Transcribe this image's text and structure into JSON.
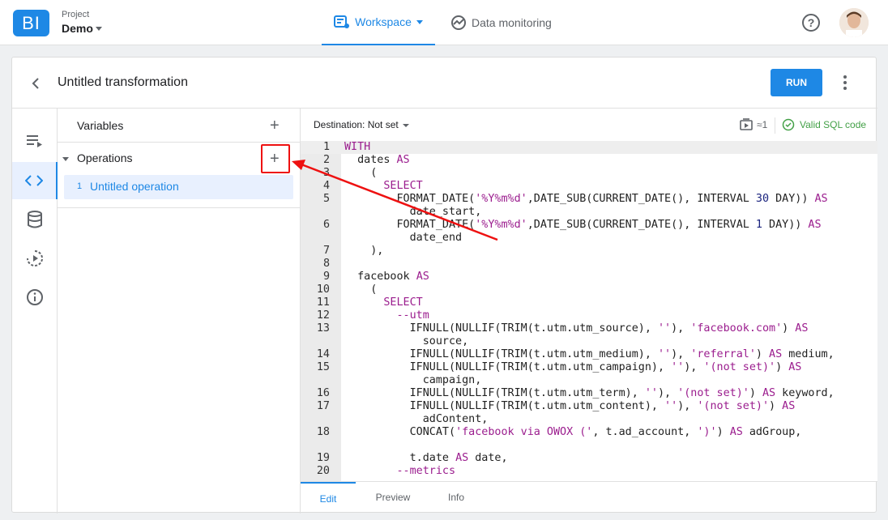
{
  "app": {
    "logo_text": "BI",
    "project_label": "Project",
    "project_name": "Demo",
    "nav": {
      "workspace": "Workspace",
      "data_monitoring": "Data monitoring"
    },
    "help_icon": "question-circle-icon",
    "accent": "#1e88e5"
  },
  "header": {
    "title": "Untitled transformation",
    "run_label": "RUN"
  },
  "panel": {
    "variables_label": "Variables",
    "operations_label": "Operations",
    "operations": [
      {
        "num": "1",
        "name": "Untitled operation"
      }
    ]
  },
  "editor": {
    "destination": "Destination: Not set",
    "run_count": "≈1",
    "valid_text": "Valid SQL code",
    "tabs": [
      "Edit",
      "Preview",
      "Info"
    ],
    "active_tab": "Edit"
  },
  "code_lines": [
    {
      "n": "1",
      "t": "WITH"
    },
    {
      "n": "2",
      "t": "  dates AS"
    },
    {
      "n": "3",
      "t": "    ("
    },
    {
      "n": "4",
      "t": "      SELECT"
    },
    {
      "n": "5",
      "t": "        FORMAT_DATE('%Y%m%d',DATE_SUB(CURRENT_DATE(), INTERVAL 30 DAY)) AS"
    },
    {
      "n": "",
      "t": "          date_start,"
    },
    {
      "n": "6",
      "t": "        FORMAT_DATE('%Y%m%d',DATE_SUB(CURRENT_DATE(), INTERVAL 1 DAY)) AS"
    },
    {
      "n": "",
      "t": "          date_end"
    },
    {
      "n": "7",
      "t": "    ),"
    },
    {
      "n": "8",
      "t": ""
    },
    {
      "n": "9",
      "t": "  facebook AS"
    },
    {
      "n": "10",
      "t": "    ("
    },
    {
      "n": "11",
      "t": "      SELECT"
    },
    {
      "n": "12",
      "t": "        --utm"
    },
    {
      "n": "13",
      "t": "          IFNULL(NULLIF(TRIM(t.utm.utm_source), ''), 'facebook.com') AS"
    },
    {
      "n": "",
      "t": "            source,"
    },
    {
      "n": "14",
      "t": "          IFNULL(NULLIF(TRIM(t.utm.utm_medium), ''), 'referral') AS medium,"
    },
    {
      "n": "15",
      "t": "          IFNULL(NULLIF(TRIM(t.utm.utm_campaign), ''), '(not set)') AS"
    },
    {
      "n": "",
      "t": "            campaign,"
    },
    {
      "n": "16",
      "t": "          IFNULL(NULLIF(TRIM(t.utm.utm_term), ''), '(not set)') AS keyword,"
    },
    {
      "n": "17",
      "t": "          IFNULL(NULLIF(TRIM(t.utm.utm_content), ''), '(not set)') AS"
    },
    {
      "n": "",
      "t": "            adContent,"
    },
    {
      "n": "18",
      "t": "          CONCAT('facebook via OWOX (', t.ad_account, ')') AS adGroup,"
    },
    {
      "n": "",
      "t": ""
    },
    {
      "n": "19",
      "t": "          t.date AS date,"
    },
    {
      "n": "20",
      "t": "        --metrics"
    }
  ]
}
